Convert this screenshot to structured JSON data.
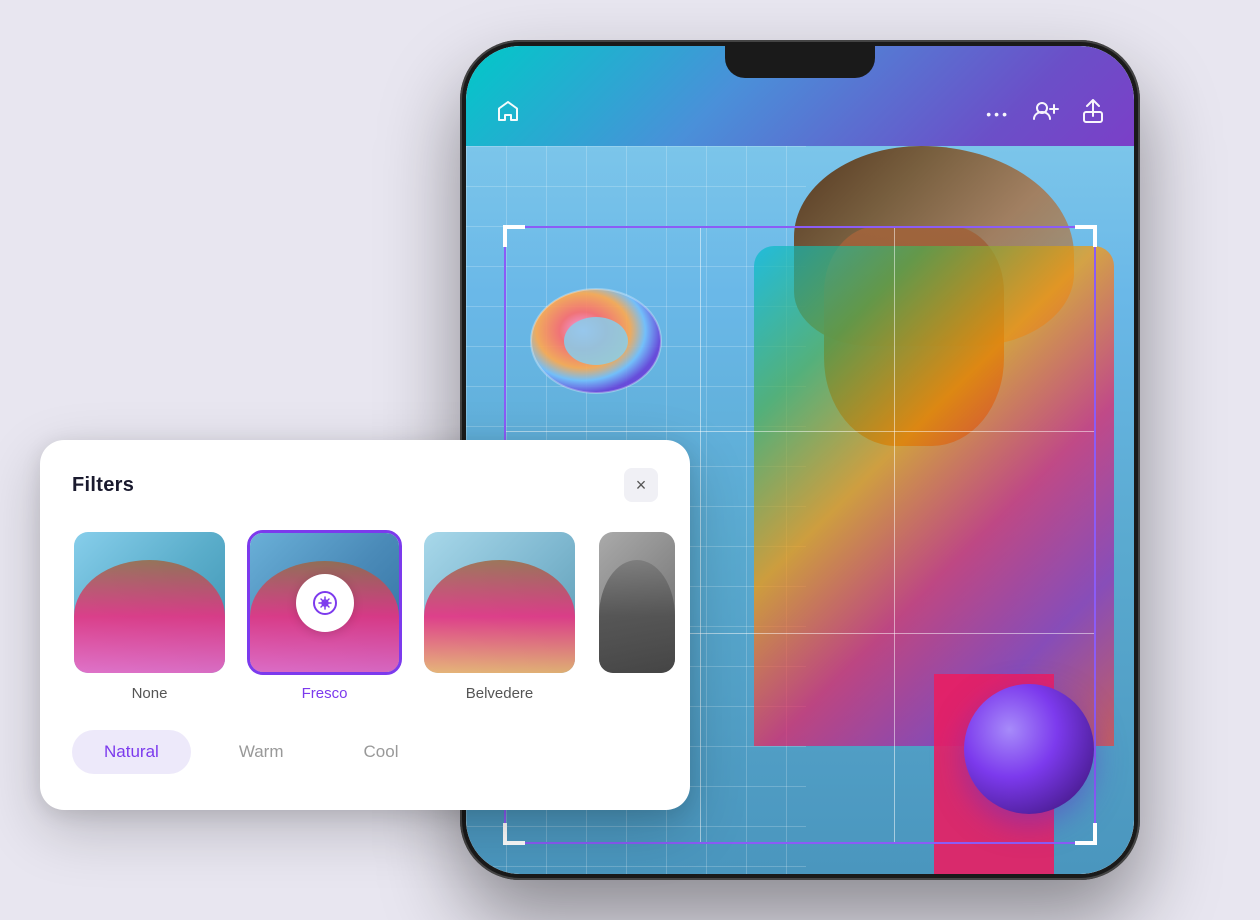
{
  "page": {
    "background_color": "#e8e6f0"
  },
  "phone": {
    "header": {
      "home_icon": "⌂",
      "more_icon": "•••",
      "add_user_icon": "👥",
      "share_icon": "↑"
    }
  },
  "filters_panel": {
    "title": "Filters",
    "close_label": "×",
    "thumbnails": [
      {
        "id": "none",
        "label": "None",
        "selected": false
      },
      {
        "id": "fresco",
        "label": "Fresco",
        "selected": true
      },
      {
        "id": "belvedere",
        "label": "Belvedere",
        "selected": false
      },
      {
        "id": "fourth",
        "label": "",
        "selected": false
      }
    ],
    "tones": [
      {
        "id": "natural",
        "label": "Natural",
        "active": true
      },
      {
        "id": "warm",
        "label": "Warm",
        "active": false
      },
      {
        "id": "cool",
        "label": "Cool",
        "active": false
      }
    ]
  }
}
